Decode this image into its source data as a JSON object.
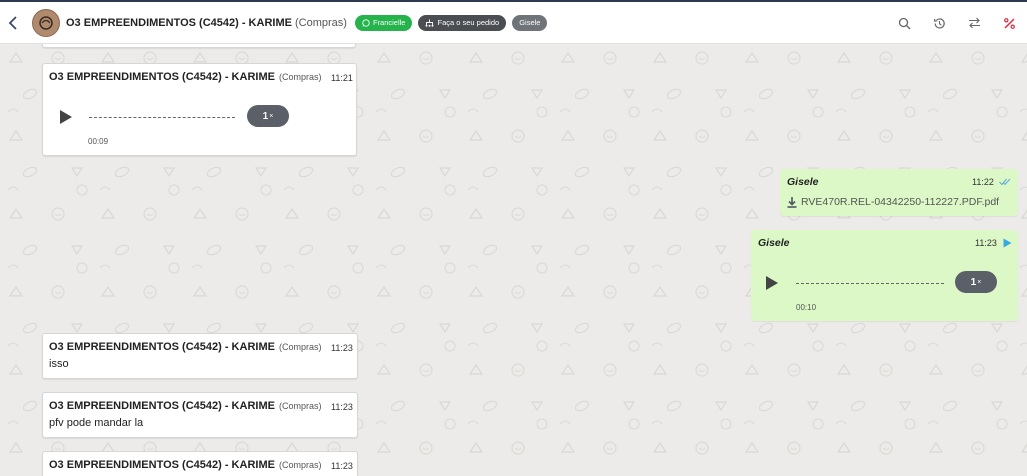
{
  "header": {
    "contact_name": "O3 EMPREENDIMENTOS (C4542) - KARIME",
    "contact_sub": "(Compras)",
    "tags": [
      {
        "label": "Francielle",
        "color": "#25b34b",
        "icon": "whatsapp-icon"
      },
      {
        "label": "Faça o seu pedido",
        "color": "#4a4d52",
        "icon": "sitemap-icon"
      },
      {
        "label": "Gisele",
        "color": "#6f747a"
      }
    ],
    "icons": [
      "search-icon",
      "history-icon",
      "transfer-icon",
      "finish-icon"
    ]
  },
  "messages": {
    "m1": {
      "sender": "O3 EMPREENDIMENTOS (C4542) - KARIME",
      "sub": "(Compras)",
      "time": "11:21",
      "speed": "1",
      "speed_x": "×",
      "duration": "00:09"
    },
    "m2": {
      "sender": "Gisele",
      "time": "11:22",
      "file": "RVE470R.REL-04342250-112227.PDF.pdf"
    },
    "m3": {
      "sender": "Gisele",
      "time": "11:23",
      "speed": "1",
      "speed_x": "×",
      "duration": "00:10"
    },
    "m4": {
      "sender": "O3 EMPREENDIMENTOS (C4542) - KARIME",
      "sub": "(Compras)",
      "time": "11:23",
      "text": "isso"
    },
    "m5": {
      "sender": "O3 EMPREENDIMENTOS (C4542) - KARIME",
      "sub": "(Compras)",
      "time": "11:23",
      "text": "pfv pode mandar la"
    },
    "m6": {
      "sender": "O3 EMPREENDIMENTOS (C4542) - KARIME",
      "sub": "(Compras)",
      "time": "11:23"
    }
  }
}
